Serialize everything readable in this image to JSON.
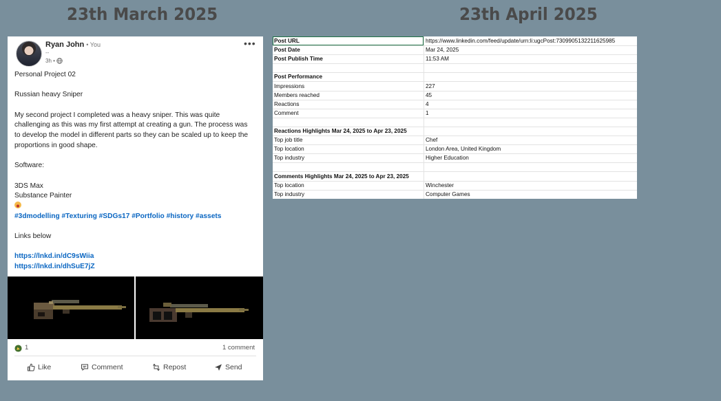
{
  "headings": {
    "left": "23th March 2025",
    "right": "23th April 2025"
  },
  "post": {
    "author": "Ryan John",
    "you_label": "• You",
    "subtitle": "--",
    "time": "3h •",
    "text_lines": [
      "Personal Project 02",
      "",
      "Russian heavy Sniper",
      "",
      "My second project I completed was a heavy sniper. This was quite",
      "challenging as this was my first attempt at creating a gun. The process was",
      "to develop the model in different parts so they can be scaled up to keep the",
      "proportions in good shape.",
      "",
      "Software:",
      "",
      "3DS Max",
      "Substance Painter"
    ],
    "hashtags": "#3dmodelling #Texturing #SDGs17 #Portfolio #history #assets",
    "links_label": "Links below",
    "links": [
      "https://lnkd.in/dC9sWiia",
      "https://lnkd.in/dhSuE7jZ"
    ],
    "reactions_count": "1",
    "comments_count": "1 comment",
    "actions": {
      "like": "Like",
      "comment": "Comment",
      "repost": "Repost",
      "send": "Send"
    }
  },
  "sheet": {
    "rows": [
      {
        "a": "Post URL",
        "b": "https://www.linkedin.com/feed/update/urn:li:ugcPost:7309905132211625985",
        "bold": true
      },
      {
        "a": "Post Date",
        "b": "Mar 24, 2025",
        "bold": true
      },
      {
        "a": "Post Publish Time",
        "b": "11:53 AM",
        "bold": true
      },
      {
        "a": "",
        "b": "",
        "bold": false
      },
      {
        "a": "Post Performance",
        "b": "",
        "bold": true
      },
      {
        "a": "Impressions",
        "b": "227",
        "bold": false
      },
      {
        "a": "Members reached",
        "b": "45",
        "bold": false
      },
      {
        "a": "Reactions",
        "b": "4",
        "bold": false
      },
      {
        "a": "Comment",
        "b": "1",
        "bold": false
      },
      {
        "a": "",
        "b": "",
        "bold": false
      },
      {
        "a": "Reactions Highlights Mar 24, 2025 to Apr 23, 2025",
        "b": "",
        "bold": true
      },
      {
        "a": "Top job title",
        "b": "Chef",
        "bold": false
      },
      {
        "a": "Top location",
        "b": "London Area, United Kingdom",
        "bold": false
      },
      {
        "a": "Top industry",
        "b": "Higher Education",
        "bold": false
      },
      {
        "a": "",
        "b": "",
        "bold": false
      },
      {
        "a": "Comments Highlights Mar 24, 2025 to Apr 23, 2025",
        "b": "",
        "bold": true
      },
      {
        "a": "Top location",
        "b": "Winchester",
        "bold": false
      },
      {
        "a": "Top industry",
        "b": "Computer Games",
        "bold": false
      }
    ]
  },
  "colors": {
    "background": "#798f9c",
    "link": "#0a66c2",
    "heading": "#4a4a4a"
  }
}
